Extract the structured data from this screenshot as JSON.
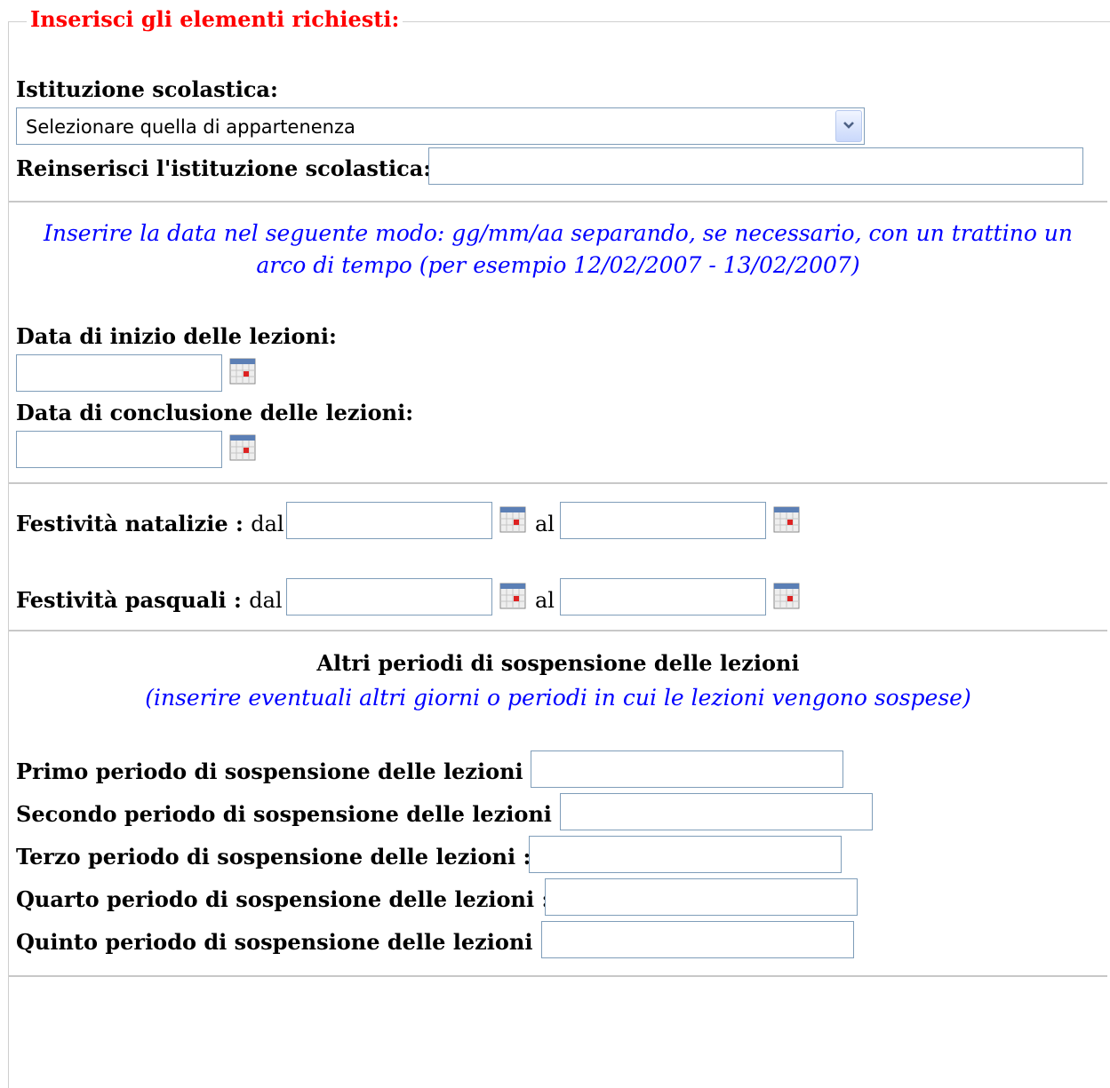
{
  "form": {
    "legend": "Inserisci gli elementi richiesti:",
    "istituzione_label": "Istituzione scolastica:",
    "istituzione_select_value": "Selezionare quella di appartenenza",
    "reinserisci_label": "Reinserisci l'istituzione scolastica:",
    "note_line1": "Inserire la data nel seguente modo: gg/mm/aa separando, se necessario, con un trattino un",
    "note_line2": "arco di tempo (per esempio 12/02/2007 - 13/02/2007)",
    "data_inizio_label": "Data di inizio delle lezioni:",
    "data_conclusione_label": "Data di conclusione delle lezioni:",
    "natalizie_label": "Festività natalizie :",
    "pasquali_label": "Festività pasquali :",
    "dal_label": "dal",
    "al_label": "al",
    "altri_title": "Altri periodi di sospensione delle lezioni",
    "altri_subtitle": "(inserire eventuali altri giorni o periodi in cui le lezioni vengono sospese)",
    "primo_label": "Primo periodo di sospensione delle lezioni :",
    "secondo_label": "Secondo periodo di sospensione delle lezioni :",
    "terzo_label": "Terzo periodo di sospensione delle lezioni :",
    "quarto_label": "Quarto periodo di sospensione delle lezioni :",
    "quinto_label": "Quinto periodo di sospensione delle lezioni :"
  },
  "icons": {
    "calendar": "calendar-icon",
    "dropdown": "chevron-down-icon"
  },
  "colors": {
    "legend": "#ff0000",
    "note": "#0000ff",
    "input_border": "#7f9db9"
  }
}
